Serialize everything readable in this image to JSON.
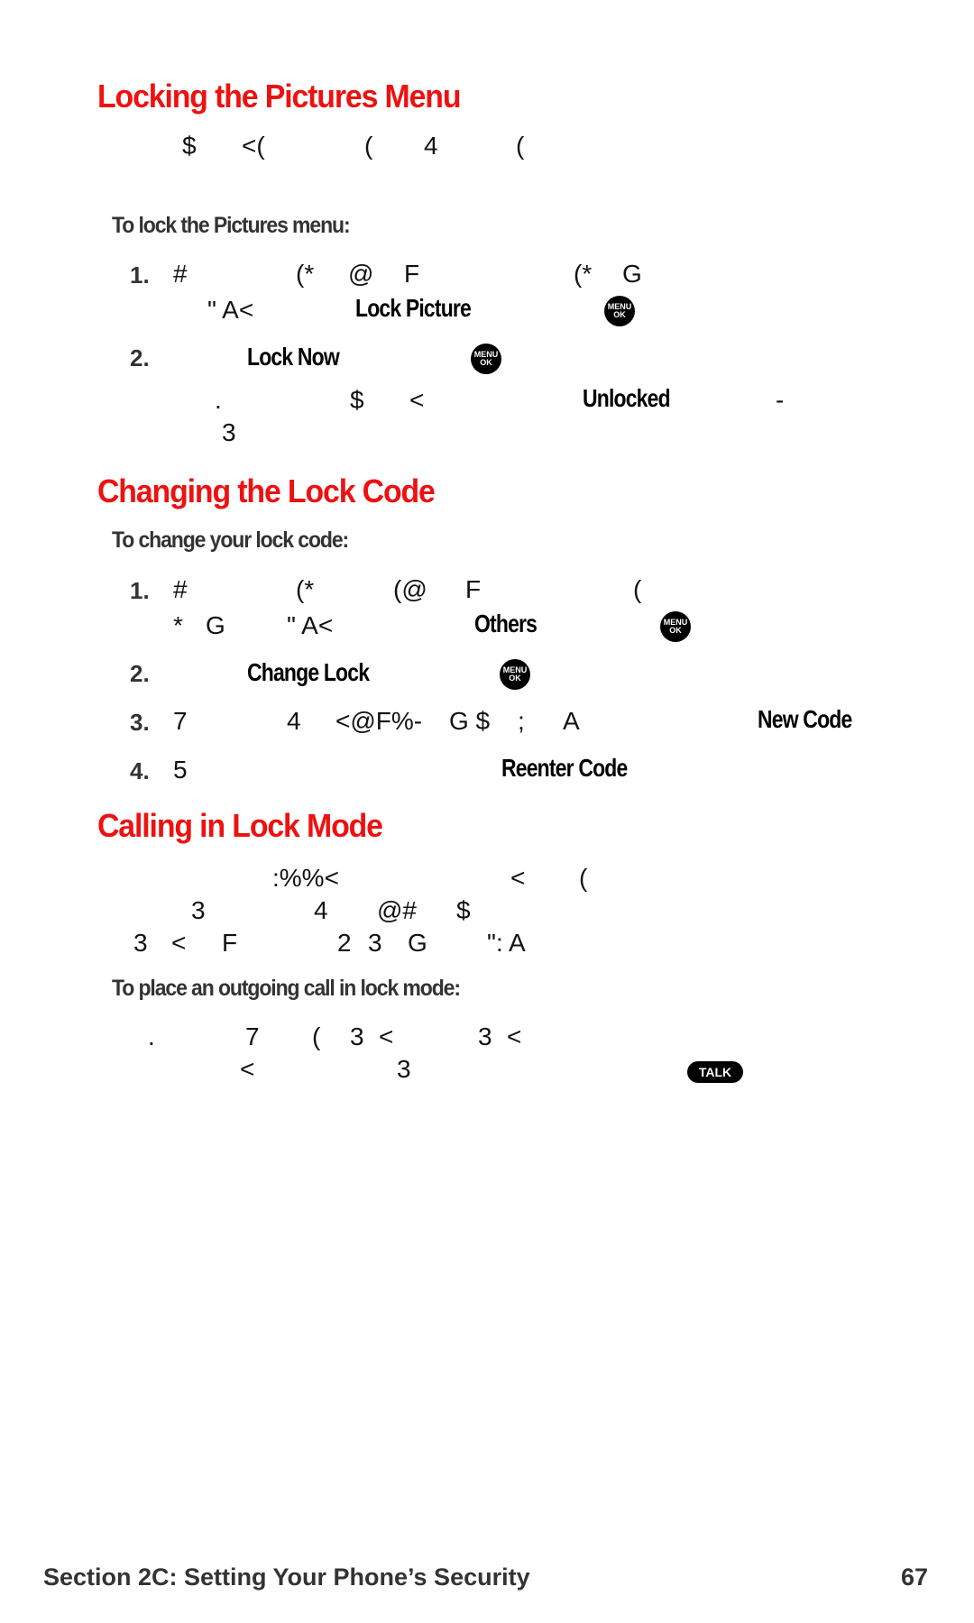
{
  "sections": [
    {
      "heading": "Locking the Pictures Menu",
      "intro_glyphs": [
        "$",
        "<(",
        "(",
        "4",
        "("
      ],
      "subheading": "To lock the Pictures menu:",
      "steps": [
        {
          "num": "1.",
          "line1_glyphs": [
            "#",
            "(*",
            "@",
            "F",
            "(*",
            "G"
          ],
          "line2_glyphs": [
            "\" A<"
          ],
          "key": "Lock Picture",
          "icon": "menu-ok-button-icon"
        },
        {
          "num": "2.",
          "key": "Lock Now",
          "icon": "menu-ok-button-icon"
        }
      ],
      "note_glyphs": [
        ".",
        "$",
        "<",
        "-",
        "3"
      ],
      "note_key": "Unlocked"
    },
    {
      "heading": "Changing the Lock Code",
      "subheading": "To change your lock code:",
      "steps": [
        {
          "num": "1.",
          "line1_glyphs": [
            "#",
            "(*",
            "(@",
            "F",
            "("
          ],
          "line2_glyphs": [
            "*",
            "G",
            "\" A<"
          ],
          "key": "Others",
          "icon": "menu-ok-button-icon"
        },
        {
          "num": "2.",
          "key": "Change Lock",
          "icon": "menu-ok-button-icon"
        },
        {
          "num": "3.",
          "glyphs": [
            "7",
            "4",
            "<@F%-",
            "G $",
            ";",
            "A"
          ],
          "key": "New Code"
        },
        {
          "num": "4.",
          "glyphs": [
            "5"
          ],
          "key": "Reenter Code"
        }
      ]
    },
    {
      "heading": "Calling in Lock Mode",
      "intro_lines": [
        [
          ":%%<",
          "<",
          "("
        ],
        [
          "3",
          "4",
          "@#",
          "$"
        ],
        [
          "3",
          "<",
          "F",
          "2",
          "3",
          "G",
          "\": A"
        ]
      ],
      "subheading": "To place an outgoing call in lock mode:",
      "body_lines": [
        [
          ".",
          "7",
          "(",
          "3",
          "<",
          "3",
          "<"
        ],
        [
          "<",
          "3"
        ]
      ],
      "icon_label": "TALK"
    }
  ],
  "icons": {
    "menu_ok": {
      "line1": "MENU",
      "line2": "OK"
    },
    "talk": "TALK"
  },
  "footer": {
    "section_title": "Section 2C: Setting Your Phone’s Security",
    "page_number": "67"
  },
  "colors": {
    "heading": "#ee1111",
    "subheading": "#333333",
    "body": "#111111"
  }
}
